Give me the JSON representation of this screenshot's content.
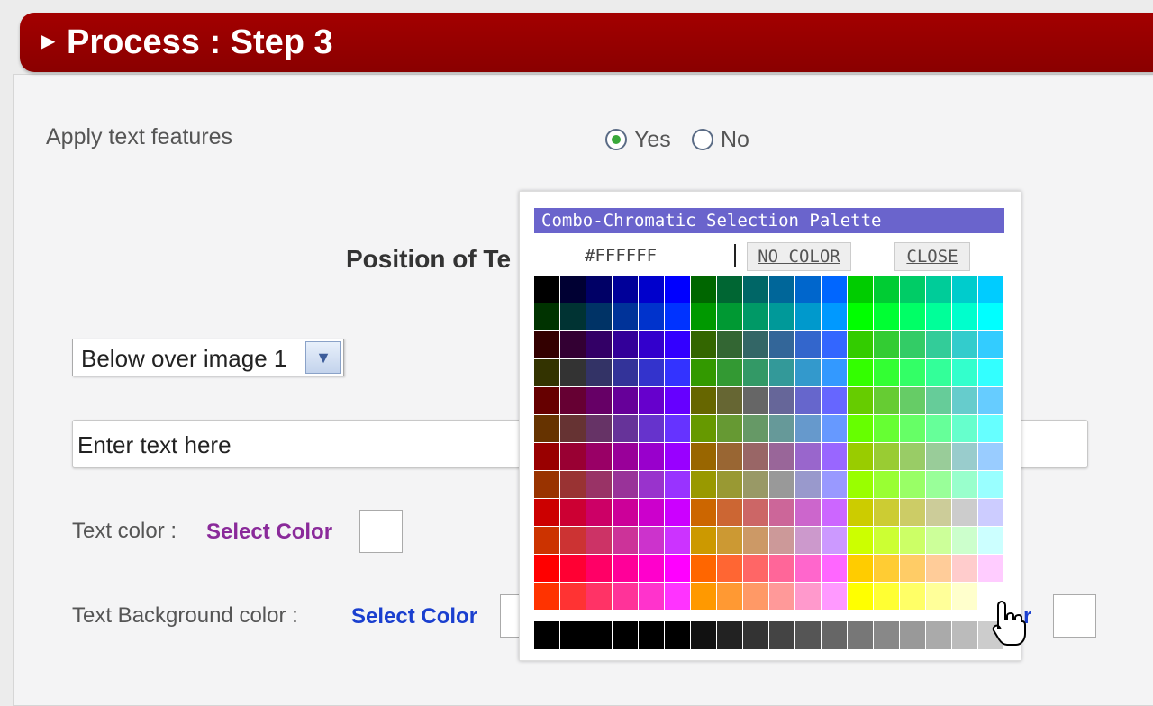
{
  "header": {
    "title": "Process : Step 3"
  },
  "apply_text": {
    "label": "Apply text features",
    "yes_label": "Yes",
    "no_label": "No",
    "selected": "Yes"
  },
  "position": {
    "title": "Position of Te",
    "selected": "Below over image 1"
  },
  "text_input": {
    "value": "Enter text here"
  },
  "text_color": {
    "label": "Text color :",
    "link": "Select Color"
  },
  "text_bg_color": {
    "label": "Text Background color :",
    "link": "Select Color",
    "link_right_fragment": "r"
  },
  "palette": {
    "title": "Combo-Chromatic Selection Palette",
    "hex_value": "#FFFFFF",
    "no_color_label": "NO COLOR",
    "close_label": "CLOSE"
  },
  "colors": {
    "header_red": "#9a0000",
    "palette_title_bg": "#6a64cc",
    "link_purple": "#8a2a9a",
    "link_blue": "#1a3fcf"
  },
  "icons": {
    "header": "triangle-right-icon",
    "select": "chevron-down-icon",
    "cursor": "hand-pointer-icon"
  }
}
